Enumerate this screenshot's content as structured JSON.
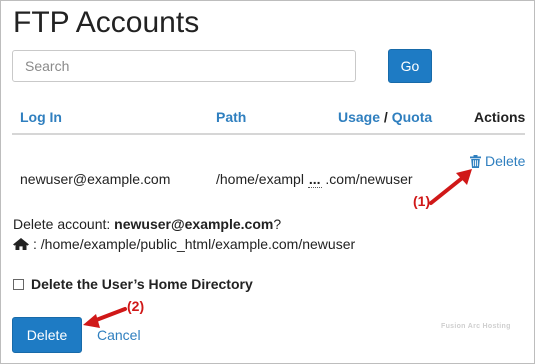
{
  "page": {
    "title": "FTP Accounts"
  },
  "search": {
    "placeholder": "Search",
    "value": "",
    "go_label": "Go"
  },
  "table": {
    "headers": {
      "login": "Log In",
      "path": "Path",
      "usage": "Usage",
      "separator": "/",
      "quota": "Quota",
      "actions": "Actions"
    },
    "row": {
      "login": "newuser@example.com",
      "path_start": "/home/exampl",
      "path_ellipsis": "...",
      "path_end": ".com/newuser",
      "delete_label": "Delete"
    }
  },
  "confirm": {
    "prefix": "Delete account: ",
    "account": "newuser@example.com",
    "suffix": "?",
    "path": ": /home/example/public_html/example.com/newuser"
  },
  "home_dir_checkbox": {
    "label": "Delete the User’s Home Directory",
    "checked": false
  },
  "buttons": {
    "delete": "Delete",
    "cancel": "Cancel"
  },
  "annotations": {
    "step1": "(1)",
    "step2": "(2)"
  },
  "watermark": "Fusion Arc Hosting",
  "colors": {
    "accent": "#1e7bc4",
    "link": "#2f7fbf",
    "annotation": "#d01818"
  }
}
